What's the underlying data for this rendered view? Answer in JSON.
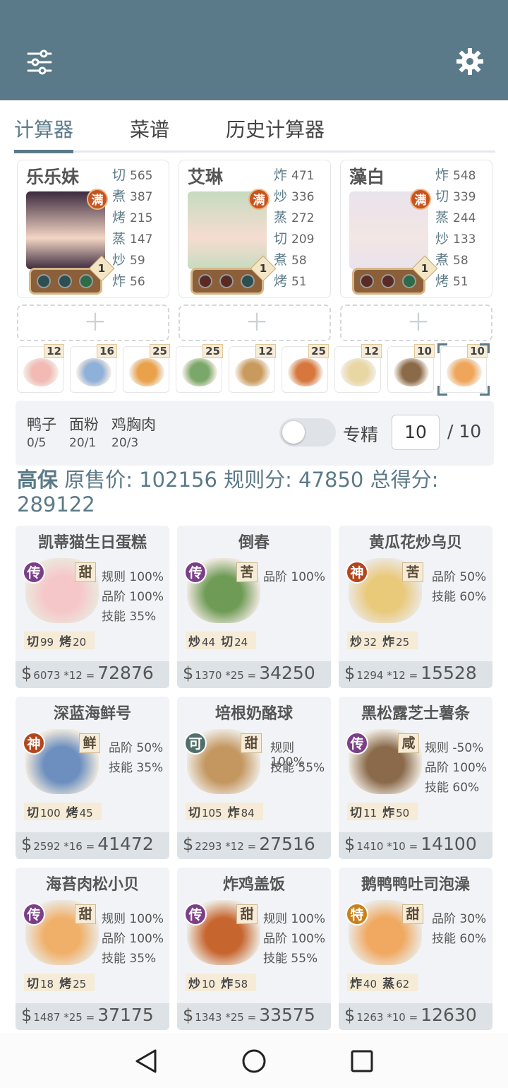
{
  "tabs": [
    "计算器",
    "菜谱",
    "历史计算器"
  ],
  "chefs": [
    {
      "name": "乐乐妹",
      "badge": "满",
      "level": "1",
      "skills": [
        [
          "切",
          "565"
        ],
        [
          "煮",
          "387"
        ],
        [
          "烤",
          "215"
        ],
        [
          "蒸",
          "147"
        ],
        [
          "炒",
          "59"
        ],
        [
          "炸",
          "56"
        ]
      ]
    },
    {
      "name": "艾琳",
      "badge": "满",
      "level": "1",
      "skills": [
        [
          "炸",
          "471"
        ],
        [
          "炒",
          "336"
        ],
        [
          "蒸",
          "272"
        ],
        [
          "切",
          "209"
        ],
        [
          "煮",
          "58"
        ],
        [
          "烤",
          "51"
        ]
      ]
    },
    {
      "name": "藻白",
      "badge": "满",
      "level": "1",
      "skills": [
        [
          "炸",
          "548"
        ],
        [
          "切",
          "339"
        ],
        [
          "蒸",
          "244"
        ],
        [
          "炒",
          "133"
        ],
        [
          "煮",
          "58"
        ],
        [
          "烤",
          "51"
        ]
      ]
    }
  ],
  "dish_counts": [
    "12",
    "16",
    "25",
    "25",
    "12",
    "25",
    "12",
    "10",
    "10"
  ],
  "ingredients": [
    {
      "name": "鸭子",
      "value": "0/5"
    },
    {
      "name": "面粉",
      "value": "20/1"
    },
    {
      "name": "鸡胸肉",
      "value": "20/3"
    }
  ],
  "specialty": {
    "label": "专精",
    "value": "10",
    "max": "/ 10"
  },
  "summary": {
    "chef": "高保",
    "text": "原售价: 102156 规则分: 47850 总得分: 289122"
  },
  "dishes": [
    {
      "title": "凯蒂猫生日蛋糕",
      "rarity": "传",
      "flavor": "甜",
      "stats": [
        "规则 100%",
        "品阶 100%",
        "技能 35%"
      ],
      "req": [
        [
          "切",
          "99"
        ],
        [
          "烤",
          "20"
        ]
      ],
      "price": "6073",
      "mult": "*12",
      "total": "72876"
    },
    {
      "title": "倒春",
      "rarity": "传",
      "flavor": "苦",
      "stats": [
        "品阶 100%"
      ],
      "req": [
        [
          "炒",
          "44"
        ],
        [
          "切",
          "24"
        ]
      ],
      "price": "1370",
      "mult": "*25",
      "total": "34250"
    },
    {
      "title": "黄瓜花炒乌贝",
      "rarity": "神",
      "flavor": "苦",
      "stats": [
        "品阶 50%",
        "技能 60%"
      ],
      "req": [
        [
          "炒",
          "32"
        ],
        [
          "炸",
          "25"
        ]
      ],
      "price": "1294",
      "mult": "*12",
      "total": "15528"
    },
    {
      "title": "深蓝海鲜号",
      "rarity": "神",
      "flavor": "鲜",
      "stats": [
        "品阶 50%",
        "技能 35%"
      ],
      "req": [
        [
          "切",
          "100"
        ],
        [
          "烤",
          "45"
        ]
      ],
      "price": "2592",
      "mult": "*16",
      "total": "41472"
    },
    {
      "title": "培根奶酪球",
      "rarity": "可",
      "flavor": "甜",
      "stats": [
        "规则 100%",
        "技能 55%"
      ],
      "req": [
        [
          "切",
          "105"
        ],
        [
          "炸",
          "84"
        ]
      ],
      "price": "2293",
      "mult": "*12",
      "total": "27516"
    },
    {
      "title": "黑松露芝士薯条",
      "rarity": "传",
      "flavor": "咸",
      "stats": [
        "规则 -50%",
        "品阶 100%",
        "技能 60%"
      ],
      "req": [
        [
          "切",
          "11"
        ],
        [
          "炸",
          "50"
        ]
      ],
      "price": "1410",
      "mult": "*10",
      "total": "14100"
    },
    {
      "title": "海苔肉松小贝",
      "rarity": "传",
      "flavor": "甜",
      "stats": [
        "规则 100%",
        "品阶 100%",
        "技能 35%"
      ],
      "req": [
        [
          "切",
          "18"
        ],
        [
          "烤",
          "25"
        ]
      ],
      "price": "1487",
      "mult": "*25",
      "total": "37175"
    },
    {
      "title": "炸鸡盖饭",
      "rarity": "传",
      "flavor": "甜",
      "stats": [
        "规则 100%",
        "品阶 100%",
        "技能 55%"
      ],
      "req": [
        [
          "炒",
          "10"
        ],
        [
          "炸",
          "58"
        ]
      ],
      "price": "1343",
      "mult": "*25",
      "total": "33575"
    },
    {
      "title": "鹅鸭鸭吐司泡澡",
      "rarity": "特",
      "flavor": "甜",
      "stats": [
        "品阶 30%",
        "技能 60%"
      ],
      "req": [
        [
          "炸",
          "40"
        ],
        [
          "蒸",
          "62"
        ]
      ],
      "price": "1263",
      "mult": "*10",
      "total": "12630"
    }
  ],
  "colors": {
    "header": "#5b7a89",
    "rarity_传": "#7b3f88",
    "rarity_神": "#b3461d",
    "rarity_可": "#4f6f6a",
    "rarity_特": "#c8811c"
  },
  "icons": {
    "menu": "sliders-icon",
    "settings": "gear-icon",
    "back": "triangle-back-icon",
    "home": "circle-home-icon",
    "recent": "square-recent-icon"
  }
}
